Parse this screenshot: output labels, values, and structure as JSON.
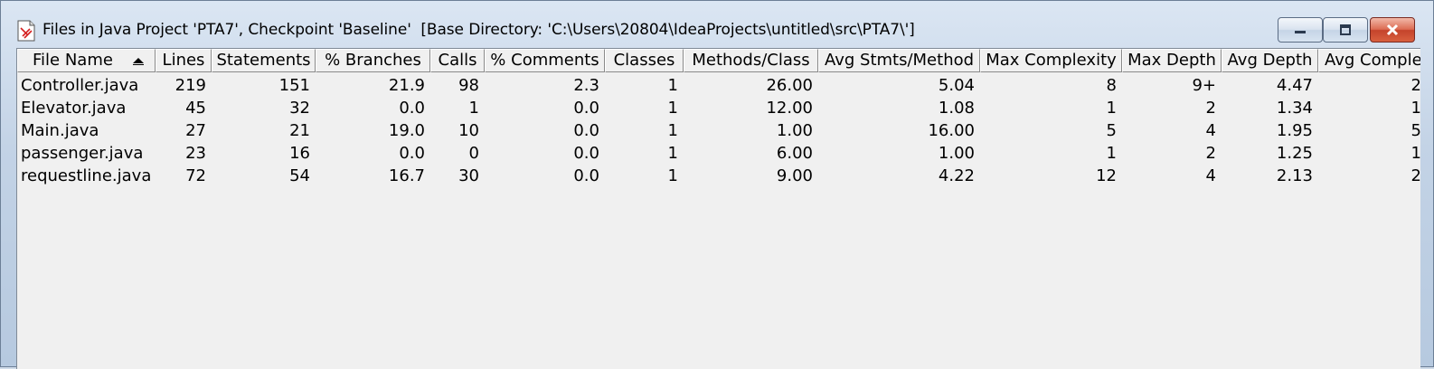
{
  "window": {
    "title": "Files in Java Project 'PTA7', Checkpoint 'Baseline'  [Base Directory: 'C:\\Users\\20804\\IdeaProjects\\untitled\\src\\PTA7\\']",
    "controls": {
      "minimize": "minimize",
      "maximize": "maximize",
      "close": "close"
    }
  },
  "table": {
    "columns": [
      "File Name",
      "Lines",
      "Statements",
      "% Branches",
      "Calls",
      "% Comments",
      "Classes",
      "Methods/Class",
      "Avg Stmts/Method",
      "Max Complexity",
      "Max Depth",
      "Avg Depth",
      "Avg Comple"
    ],
    "sort_column": "File Name",
    "rows": [
      [
        "Controller.java",
        "219",
        "151",
        "21.9",
        "98",
        "2.3",
        "1",
        "26.00",
        "5.04",
        "8",
        "9+",
        "4.47",
        "2"
      ],
      [
        "Elevator.java",
        "45",
        "32",
        "0.0",
        "1",
        "0.0",
        "1",
        "12.00",
        "1.08",
        "1",
        "2",
        "1.34",
        "1"
      ],
      [
        "Main.java",
        "27",
        "21",
        "19.0",
        "10",
        "0.0",
        "1",
        "1.00",
        "16.00",
        "5",
        "4",
        "1.95",
        "5"
      ],
      [
        "passenger.java",
        "23",
        "16",
        "0.0",
        "0",
        "0.0",
        "1",
        "6.00",
        "1.00",
        "1",
        "2",
        "1.25",
        "1"
      ],
      [
        "requestline.java",
        "72",
        "54",
        "16.7",
        "30",
        "0.0",
        "1",
        "9.00",
        "4.22",
        "12",
        "4",
        "2.13",
        "2"
      ]
    ]
  }
}
